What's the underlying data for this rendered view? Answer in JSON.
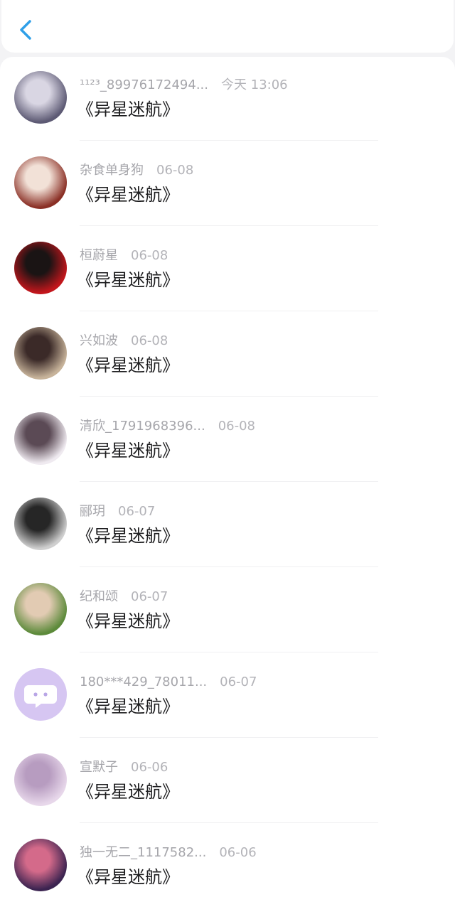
{
  "header": {
    "back_icon": "chevron-left-icon",
    "accent": "#2f9fe8"
  },
  "comments": [
    {
      "user": "¹¹²³_89976172494...",
      "time": "今天 13:06",
      "text": "《异星迷航》",
      "avatar_colors": [
        "#5d5a74",
        "#d9d6e3"
      ]
    },
    {
      "user": "杂食单身狗",
      "time": "06-08",
      "text": "《异星迷航》",
      "avatar_colors": [
        "#8a2f25",
        "#f2e1d7"
      ]
    },
    {
      "user": "桓蔚星",
      "time": "06-08",
      "text": "《异星迷航》",
      "avatar_colors": [
        "#c2161c",
        "#1a1414"
      ]
    },
    {
      "user": "兴如波",
      "time": "06-08",
      "text": "《异星迷航》",
      "avatar_colors": [
        "#c7b39a",
        "#3b2a28"
      ]
    },
    {
      "user": "清欣_1791968396...",
      "time": "06-08",
      "text": "《异星迷航》",
      "avatar_colors": [
        "#efeaf0",
        "#5b4a55"
      ]
    },
    {
      "user": "郦玥",
      "time": "06-07",
      "text": "《异星迷航》",
      "avatar_colors": [
        "#cfcfcf",
        "#262626"
      ]
    },
    {
      "user": "纪和颂",
      "time": "06-07",
      "text": "《异星迷航》",
      "avatar_colors": [
        "#5c8a3a",
        "#e2cbb3"
      ]
    },
    {
      "user": "180***429_78011...",
      "time": "06-07",
      "text": "《异星迷航》",
      "avatar_colors": [
        "#d6c6f2",
        "#ffffff"
      ]
    },
    {
      "user": "宣默子",
      "time": "06-06",
      "text": "《异星迷航》",
      "avatar_colors": [
        "#e7d7ea",
        "#b79cc0"
      ]
    },
    {
      "user": "独一无二_1117582...",
      "time": "06-06",
      "text": "《异星迷航》",
      "avatar_colors": [
        "#3b2350",
        "#d46a8a"
      ]
    }
  ]
}
